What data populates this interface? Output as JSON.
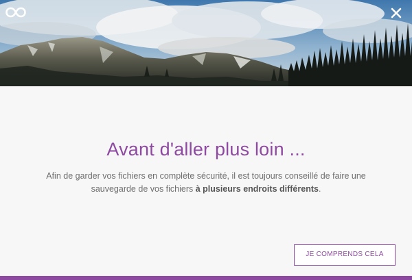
{
  "dialog": {
    "logo_icon": "infinity-icon",
    "close_icon": "close-icon",
    "title": "Avant d'aller plus loin ...",
    "message_prefix": "Afin de garder vos fichiers en complète sécurité, il est toujours conseillé de faire une sauvegarde de vos fichiers ",
    "message_bold": "à plusieurs endroits différents",
    "message_suffix": ".",
    "confirm_label": "JE COMPRENDS CELA"
  },
  "colors": {
    "accent": "#8e4aa0",
    "background": "#f7f7f8",
    "text": "#6f6f6f"
  }
}
